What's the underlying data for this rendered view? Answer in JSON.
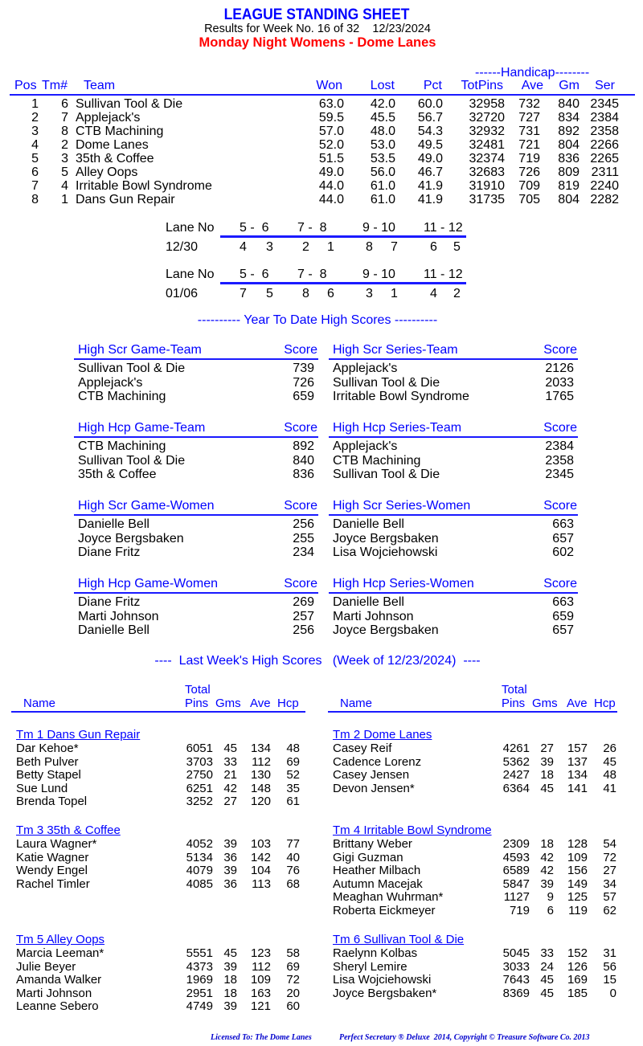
{
  "header": {
    "title": "LEAGUE STANDING SHEET",
    "subtitle": "Results for Week No. 16 of 32    12/23/2024",
    "league": "Monday Night Womens - Dome Lanes"
  },
  "standings": {
    "handicap_label": "------Handicap--------",
    "columns": [
      "Pos",
      "Tm#",
      "Team",
      "Won",
      "Lost",
      "Pct",
      "TotPins",
      "Ave",
      "Gm",
      "Ser"
    ],
    "rows": [
      {
        "pos": "1",
        "tm": "6",
        "team": "Sullivan Tool & Die",
        "won": "63.0",
        "lost": "42.0",
        "pct": "60.0",
        "totpins": "32958",
        "ave": "732",
        "gm": "840",
        "ser": "2345"
      },
      {
        "pos": "2",
        "tm": "7",
        "team": "Applejack's",
        "won": "59.5",
        "lost": "45.5",
        "pct": "56.7",
        "totpins": "32720",
        "ave": "727",
        "gm": "834",
        "ser": "2384"
      },
      {
        "pos": "3",
        "tm": "8",
        "team": "CTB Machining",
        "won": "57.0",
        "lost": "48.0",
        "pct": "54.3",
        "totpins": "32932",
        "ave": "731",
        "gm": "892",
        "ser": "2358"
      },
      {
        "pos": "4",
        "tm": "2",
        "team": "Dome Lanes",
        "won": "52.0",
        "lost": "53.0",
        "pct": "49.5",
        "totpins": "32481",
        "ave": "721",
        "gm": "804",
        "ser": "2266"
      },
      {
        "pos": "5",
        "tm": "3",
        "team": "35th & Coffee",
        "won": "51.5",
        "lost": "53.5",
        "pct": "49.0",
        "totpins": "32374",
        "ave": "719",
        "gm": "836",
        "ser": "2265"
      },
      {
        "pos": "6",
        "tm": "5",
        "team": "Alley Oops",
        "won": "49.0",
        "lost": "56.0",
        "pct": "46.7",
        "totpins": "32683",
        "ave": "726",
        "gm": "809",
        "ser": "2311"
      },
      {
        "pos": "7",
        "tm": "4",
        "team": "Irritable Bowl Syndrome",
        "won": "44.0",
        "lost": "61.0",
        "pct": "41.9",
        "totpins": "31910",
        "ave": "709",
        "gm": "819",
        "ser": "2240"
      },
      {
        "pos": "8",
        "tm": "1",
        "team": "Dans Gun Repair",
        "won": "44.0",
        "lost": "61.0",
        "pct": "41.9",
        "totpins": "31735",
        "ave": "705",
        "gm": "804",
        "ser": "2282"
      }
    ]
  },
  "lanes": [
    {
      "label": "Lane No",
      "date": "12/30",
      "pairs": [
        "5 -  6",
        "7 -  8",
        "9 - 10",
        "11 - 12"
      ],
      "teams": [
        [
          "4",
          "3"
        ],
        [
          "2",
          "1"
        ],
        [
          "8",
          "7"
        ],
        [
          "6",
          "5"
        ]
      ]
    },
    {
      "label": "Lane No",
      "date": "01/06",
      "pairs": [
        "5 -  6",
        "7 -  8",
        "9 - 10",
        "11 - 12"
      ],
      "teams": [
        [
          "7",
          "5"
        ],
        [
          "8",
          "6"
        ],
        [
          "3",
          "1"
        ],
        [
          "4",
          "2"
        ]
      ]
    }
  ],
  "ytd": {
    "heading": "---------- Year To Date High Scores ----------",
    "score_label": "Score",
    "blocks": [
      {
        "title": "High Scr Game-Team",
        "entries": [
          [
            "Sullivan Tool & Die",
            "739"
          ],
          [
            "Applejack's",
            "726"
          ],
          [
            "CTB Machining",
            "659"
          ]
        ]
      },
      {
        "title": "High Scr Series-Team",
        "entries": [
          [
            "Applejack's",
            "2126"
          ],
          [
            "Sullivan Tool & Die",
            "2033"
          ],
          [
            "Irritable Bowl Syndrome",
            "1765"
          ]
        ]
      },
      {
        "title": "High Hcp Game-Team",
        "entries": [
          [
            "CTB Machining",
            "892"
          ],
          [
            "Sullivan Tool & Die",
            "840"
          ],
          [
            "35th & Coffee",
            "836"
          ]
        ]
      },
      {
        "title": "High Hcp Series-Team",
        "entries": [
          [
            "Applejack's",
            "2384"
          ],
          [
            "CTB Machining",
            "2358"
          ],
          [
            "Sullivan Tool & Die",
            "2345"
          ]
        ]
      },
      {
        "title": "High Scr Game-Women",
        "entries": [
          [
            "Danielle Bell",
            "256"
          ],
          [
            "Joyce Bergsbaken",
            "255"
          ],
          [
            "Diane Fritz",
            "234"
          ]
        ]
      },
      {
        "title": "High Scr Series-Women",
        "entries": [
          [
            "Danielle Bell",
            "663"
          ],
          [
            "Joyce Bergsbaken",
            "657"
          ],
          [
            "Lisa Wojciehowski",
            "602"
          ]
        ]
      },
      {
        "title": "High Hcp Game-Women",
        "entries": [
          [
            "Diane Fritz",
            "269"
          ],
          [
            "Marti Johnson",
            "257"
          ],
          [
            "Danielle Bell",
            "256"
          ]
        ]
      },
      {
        "title": "High Hcp Series-Women",
        "entries": [
          [
            "Danielle Bell",
            "663"
          ],
          [
            "Marti Johnson",
            "659"
          ],
          [
            "Joyce Bergsbaken",
            "657"
          ]
        ]
      }
    ]
  },
  "lastweek": {
    "heading": "----  Last Week's High Scores   (Week of 12/23/2024)  ----",
    "col_total": "Total",
    "col_name": "Name",
    "col_pins": "Pins",
    "col_gms": "Gms",
    "col_ave": "Ave",
    "col_hcp": "Hcp",
    "teams": [
      {
        "title": "Tm 1 Dans Gun Repair",
        "players": [
          [
            "Dar Kehoe*",
            "6051",
            "45",
            "134",
            "48"
          ],
          [
            "Beth Pulver",
            "3703",
            "33",
            "112",
            "69"
          ],
          [
            "Betty Stapel",
            "2750",
            "21",
            "130",
            "52"
          ],
          [
            "Sue Lund",
            "6251",
            "42",
            "148",
            "35"
          ],
          [
            "Brenda Topel",
            "3252",
            "27",
            "120",
            "61"
          ]
        ]
      },
      {
        "title": "Tm 2 Dome Lanes",
        "players": [
          [
            "Casey Reif",
            "4261",
            "27",
            "157",
            "26"
          ],
          [
            "Cadence Lorenz",
            "5362",
            "39",
            "137",
            "45"
          ],
          [
            "Casey Jensen",
            "2427",
            "18",
            "134",
            "48"
          ],
          [
            "Devon Jensen*",
            "6364",
            "45",
            "141",
            "41"
          ]
        ]
      },
      {
        "title": "Tm 3 35th & Coffee",
        "players": [
          [
            "Laura Wagner*",
            "4052",
            "39",
            "103",
            "77"
          ],
          [
            "Katie Wagner",
            "5134",
            "36",
            "142",
            "40"
          ],
          [
            "Wendy Engel",
            "4079",
            "39",
            "104",
            "76"
          ],
          [
            "Rachel Timler",
            "4085",
            "36",
            "113",
            "68"
          ]
        ]
      },
      {
        "title": "Tm 4 Irritable Bowl Syndrome",
        "players": [
          [
            "Brittany Weber",
            "2309",
            "18",
            "128",
            "54"
          ],
          [
            "Gigi Guzman",
            "4593",
            "42",
            "109",
            "72"
          ],
          [
            "Heather Milbach",
            "6589",
            "42",
            "156",
            "27"
          ],
          [
            "Autumn Macejak",
            "5847",
            "39",
            "149",
            "34"
          ],
          [
            "Meaghan Wuhrman*",
            "1127",
            "9",
            "125",
            "57"
          ],
          [
            "Roberta Eickmeyer",
            "719",
            "6",
            "119",
            "62"
          ]
        ]
      },
      {
        "title": "Tm 5 Alley Oops",
        "players": [
          [
            "Marcia Leeman*",
            "5551",
            "45",
            "123",
            "58"
          ],
          [
            "Julie Beyer",
            "4373",
            "39",
            "112",
            "69"
          ],
          [
            "Amanda Walker",
            "1969",
            "18",
            "109",
            "72"
          ],
          [
            "Marti Johnson",
            "2951",
            "18",
            "163",
            "20"
          ],
          [
            "Leanne Sebero",
            "4749",
            "39",
            "121",
            "60"
          ]
        ]
      },
      {
        "title": "Tm 6 Sullivan Tool & Die",
        "players": [
          [
            "Raelynn Kolbas",
            "5045",
            "33",
            "152",
            "31"
          ],
          [
            "Sheryl Lemire",
            "3033",
            "24",
            "126",
            "56"
          ],
          [
            "Lisa Wojciehowski",
            "7643",
            "45",
            "169",
            "15"
          ],
          [
            "Joyce Bergsbaken*",
            "8369",
            "45",
            "185",
            "0"
          ]
        ]
      }
    ]
  },
  "footer": {
    "licensed": "Licensed To: The Dome Lanes",
    "copyright": "Perfect Secretary ® Deluxe  2014, Copyright © Treasure Software Co. 2013"
  }
}
